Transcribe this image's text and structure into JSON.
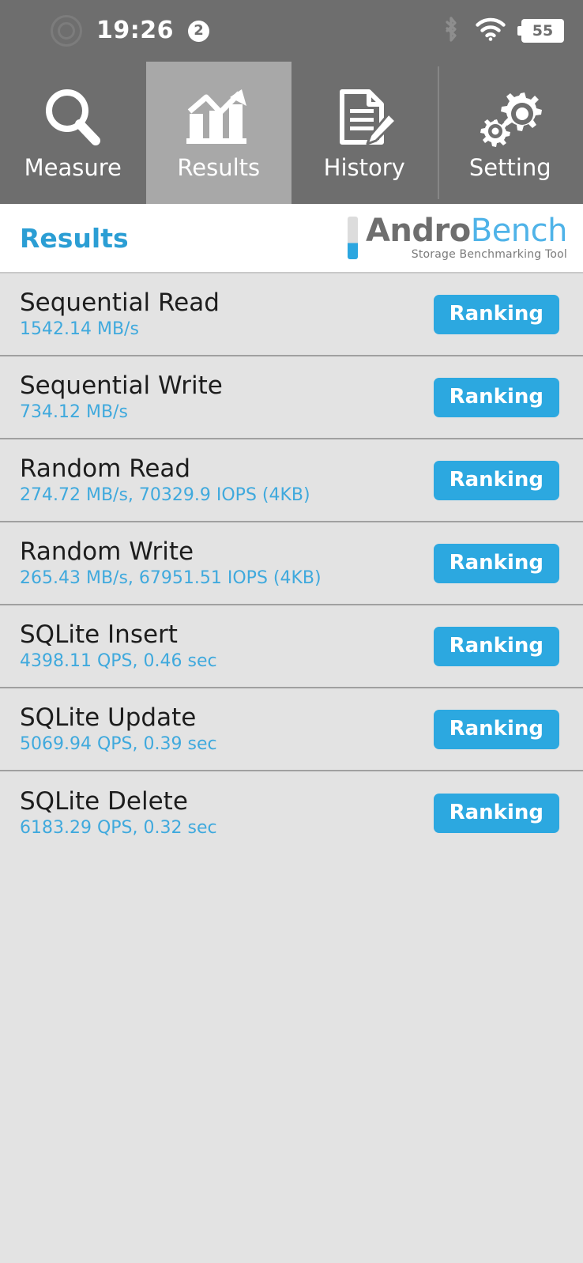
{
  "status_bar": {
    "camera_icon": "camera-punch-hole",
    "time": "19:26",
    "notification_count": "2",
    "bluetooth_icon": "bluetooth-icon",
    "wifi_icon": "wifi-icon",
    "battery_level": "55"
  },
  "tabs": [
    {
      "label": "Measure",
      "icon": "magnifier-icon",
      "selected": false
    },
    {
      "label": "Results",
      "icon": "bar-chart-icon",
      "selected": true
    },
    {
      "label": "History",
      "icon": "document-pencil-icon",
      "selected": false
    },
    {
      "label": "Setting",
      "icon": "gears-icon",
      "selected": false
    }
  ],
  "header": {
    "title": "Results",
    "logo_primary": "Andro",
    "logo_secondary": "Bench",
    "logo_tagline": "Storage Benchmarking Tool"
  },
  "results": [
    {
      "title": "Sequential Read",
      "value": "1542.14 MB/s",
      "button": "Ranking"
    },
    {
      "title": "Sequential Write",
      "value": "734.12 MB/s",
      "button": "Ranking"
    },
    {
      "title": "Random Read",
      "value": "274.72 MB/s, 70329.9 IOPS (4KB)",
      "button": "Ranking"
    },
    {
      "title": "Random Write",
      "value": "265.43 MB/s, 67951.51 IOPS (4KB)",
      "button": "Ranking"
    },
    {
      "title": "SQLite Insert",
      "value": "4398.11 QPS, 0.46 sec",
      "button": "Ranking"
    },
    {
      "title": "SQLite Update",
      "value": "5069.94 QPS, 0.39 sec",
      "button": "Ranking"
    },
    {
      "title": "SQLite Delete",
      "value": "6183.29 QPS, 0.32 sec",
      "button": "Ranking"
    }
  ],
  "colors": {
    "accent_blue": "#2ca8e0",
    "value_blue": "#3fa9dd",
    "statusbar_gray": "#6e6e6e",
    "selected_tab_gray": "#a8a8a8",
    "list_bg": "#e3e3e3"
  }
}
